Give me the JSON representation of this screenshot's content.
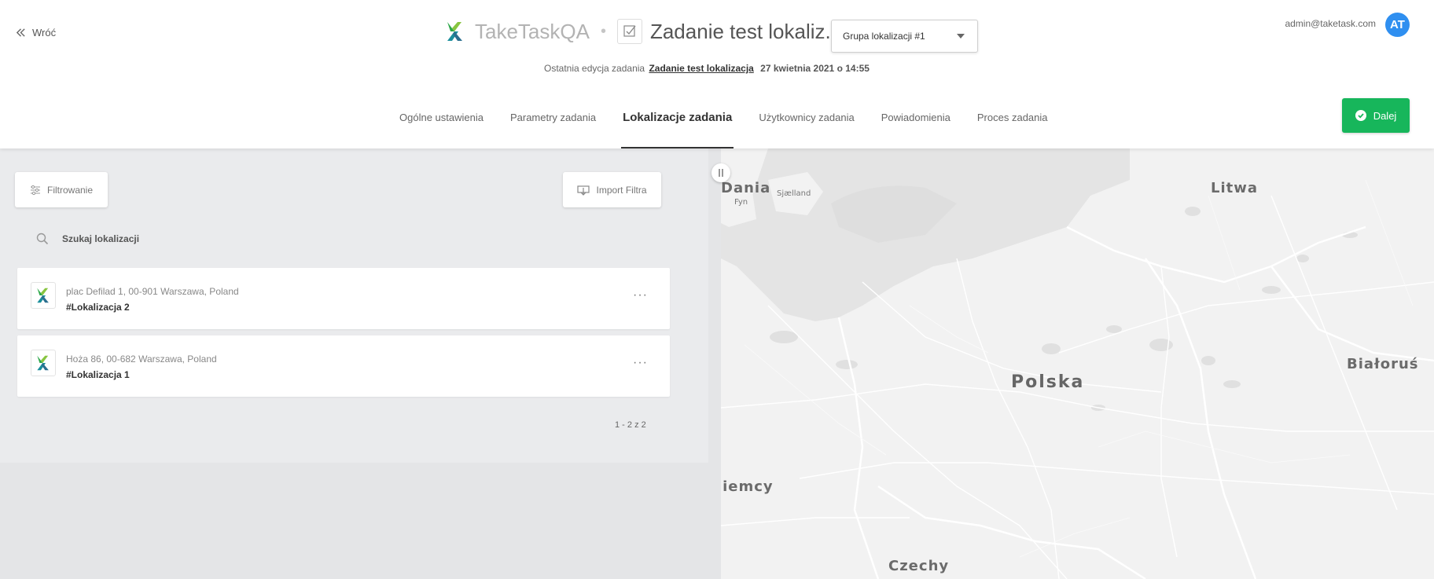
{
  "header": {
    "back_label": "Wróć",
    "brand_name": "TakeTaskQA",
    "separator": "•",
    "task_title": "Zadanie test lokaliz...",
    "group_select": {
      "selected": "Grupa lokalizacji #1"
    },
    "last_edit": {
      "prefix": "Ostatnia edycja zadania",
      "task_link": "Zadanie test lokalizacja",
      "date": "27 kwietnia 2021 o 14:55"
    },
    "user": {
      "email": "admin@taketask.com",
      "initials": "AT"
    }
  },
  "tabs": [
    {
      "label": "Ogólne ustawienia"
    },
    {
      "label": "Parametry zadania"
    },
    {
      "label": "Lokalizacje zadania",
      "active": true
    },
    {
      "label": "Użytkownicy zadania"
    },
    {
      "label": "Powiadomienia"
    },
    {
      "label": "Proces zadania"
    }
  ],
  "next_button": {
    "label": "Dalej"
  },
  "left_panel": {
    "filter_label": "Filtrowanie",
    "import_label": "Import Filtra",
    "search_placeholder": "Szukaj lokalizacji",
    "locations": [
      {
        "address": "plac Defilad 1, 00-901 Warszawa, Poland",
        "name": "#Lokalizacja 2"
      },
      {
        "address": "Hoża 86, 00-682 Warszawa, Poland",
        "name": "#Lokalizacja 1"
      }
    ],
    "more_label": "···",
    "pagination": "1 - 2 z 2"
  },
  "map": {
    "labels": {
      "dania": "Dania",
      "sjaelland": "Sjælland",
      "fyn": "Fyn",
      "litwa": "Litwa",
      "polska": "Polska",
      "bialorus": "Białoruś",
      "niemcy": "Niemcy",
      "czechy": "Czechy"
    }
  },
  "colors": {
    "accent_green": "#17b65b",
    "avatar_blue": "#2f8ff0",
    "panel_bg": "#eaebed",
    "map_land": "#f2f2f2",
    "map_water": "#e3e3e3"
  },
  "icons": {
    "back": "double-chevron-left-icon",
    "task": "checkbox-icon",
    "filter": "sliders-icon",
    "import": "import-icon",
    "search": "search-icon",
    "more": "ellipsis-icon",
    "next": "check-circle-icon"
  }
}
